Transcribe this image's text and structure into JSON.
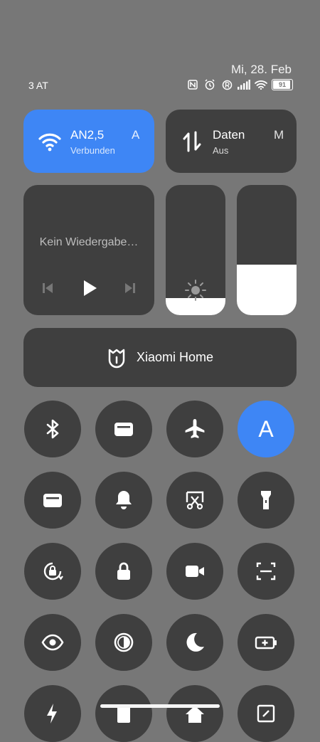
{
  "status_bar": {
    "date": "Mi, 28. Feb",
    "carrier": "3 AT",
    "battery": "91",
    "icons": [
      "nfc-icon",
      "alarm-icon",
      "registered-icon",
      "signal-icon",
      "wifi-icon",
      "battery-icon"
    ]
  },
  "wifi_tile": {
    "title": "AN2,5",
    "title_overflow": "A",
    "subtitle": "Verbunden",
    "icon": "wifi-icon",
    "color": "#3e86f5"
  },
  "data_tile": {
    "title": "Daten",
    "title_overflow": "M",
    "subtitle": "Aus",
    "icon": "mobile-data-icon"
  },
  "media": {
    "label": "Kein Wiedergabe…",
    "controls": [
      "previous-icon",
      "play-icon",
      "next-icon"
    ]
  },
  "brightness": {
    "level": 0.13,
    "icon": "sun-icon"
  },
  "volume": {
    "level": 0.39
  },
  "home_tile": {
    "label": "Xiaomi Home",
    "icon": "xiaomi-home-icon"
  },
  "toggles": [
    {
      "name": "bluetooth",
      "icon": "bluetooth-icon",
      "on": false
    },
    {
      "name": "card",
      "icon": "card-icon",
      "on": false
    },
    {
      "name": "airplane",
      "icon": "airplane-icon",
      "on": false
    },
    {
      "name": "auto-brightness",
      "label": "A",
      "on": true
    },
    {
      "name": "wallet",
      "icon": "wallet-icon",
      "on": false
    },
    {
      "name": "sound",
      "icon": "bell-icon",
      "on": false
    },
    {
      "name": "screenshot",
      "icon": "scissors-icon",
      "on": false
    },
    {
      "name": "flashlight",
      "icon": "flashlight-icon",
      "on": false
    },
    {
      "name": "rotation-lock",
      "icon": "rotation-lock-icon",
      "on": false
    },
    {
      "name": "lock-screen",
      "icon": "lock-icon",
      "on": false
    },
    {
      "name": "screen-recorder",
      "icon": "video-camera-icon",
      "on": false
    },
    {
      "name": "scanner",
      "icon": "scan-icon",
      "on": false
    },
    {
      "name": "reading-mode",
      "icon": "eye-icon",
      "on": false
    },
    {
      "name": "dark-mode",
      "icon": "contrast-icon",
      "on": false
    },
    {
      "name": "do-not-disturb",
      "icon": "moon-icon",
      "on": false
    },
    {
      "name": "battery-saver",
      "icon": "battery-plus-icon",
      "on": false
    }
  ]
}
